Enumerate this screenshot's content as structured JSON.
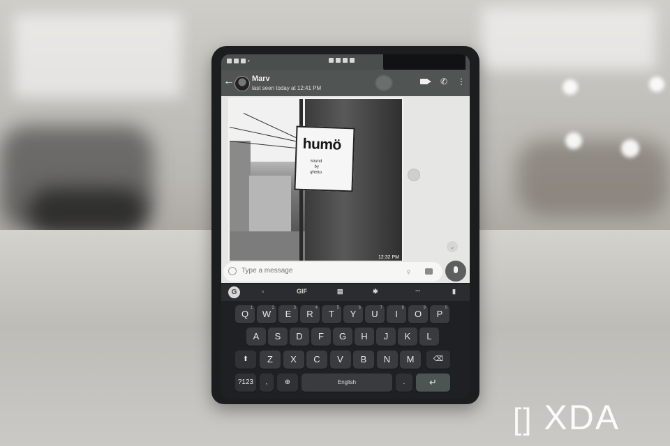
{
  "chat_header": {
    "contact_name": "Marv",
    "last_seen": "last seen today at 12:41 PM"
  },
  "message": {
    "photo_sign_title": "humö",
    "photo_sign_lines": [
      "sound",
      "by",
      "ghetto"
    ],
    "timestamp": "12:32 PM"
  },
  "composer": {
    "placeholder": "Type a message"
  },
  "keyboard": {
    "toolbar_gif": "GIF",
    "toolbar_more": "...",
    "row1": [
      {
        "label": "Q",
        "hint": "1"
      },
      {
        "label": "W",
        "hint": "2"
      },
      {
        "label": "E",
        "hint": "3"
      },
      {
        "label": "R",
        "hint": "4"
      },
      {
        "label": "T",
        "hint": "5"
      },
      {
        "label": "Y",
        "hint": "6"
      },
      {
        "label": "U",
        "hint": "7"
      },
      {
        "label": "I",
        "hint": "8"
      },
      {
        "label": "O",
        "hint": "9"
      },
      {
        "label": "P",
        "hint": "0"
      }
    ],
    "row2": [
      "A",
      "S",
      "D",
      "F",
      "G",
      "H",
      "J",
      "K",
      "L"
    ],
    "row3": [
      "Z",
      "X",
      "C",
      "V",
      "B",
      "N",
      "M"
    ],
    "symbols_label": "?123",
    "comma_label": ",",
    "space_label": "English",
    "period_label": ".",
    "enter_label": "↵",
    "shift_label": "⬆",
    "backspace_label": "⌫"
  },
  "watermark": {
    "brand": "XDA"
  },
  "colors": {
    "appbar": "#505452",
    "keyboard_bg": "#1f2023",
    "key": "#3a3b3e",
    "chat_bg": "#e6e6e4"
  }
}
